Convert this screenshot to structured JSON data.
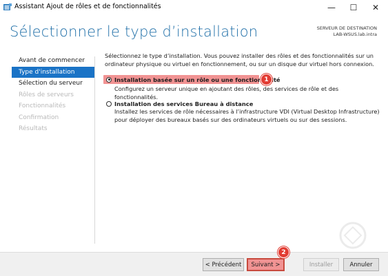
{
  "window": {
    "title": "Assistant Ajout de rôles et de fonctionnalités",
    "minimize_glyph": "—",
    "maximize_glyph": "☐",
    "close_glyph": "✕"
  },
  "header": {
    "title": "Sélectionner le type d’installation",
    "destination_label": "SERVEUR DE DESTINATION",
    "destination_server": "LAB-WSUS.lab.intra"
  },
  "nav": {
    "items": [
      {
        "label": "Avant de commencer",
        "state": "normal"
      },
      {
        "label": "Type d'installation",
        "state": "active"
      },
      {
        "label": "Sélection du serveur",
        "state": "normal"
      },
      {
        "label": "Rôles de serveurs",
        "state": "disabled"
      },
      {
        "label": "Fonctionnalités",
        "state": "disabled"
      },
      {
        "label": "Confirmation",
        "state": "disabled"
      },
      {
        "label": "Résultats",
        "state": "disabled"
      }
    ]
  },
  "content": {
    "intro": "Sélectionnez le type d’installation. Vous pouvez installer des rôles et des fonctionnalités sur un ordinateur physique ou virtuel en fonctionnement, ou sur un disque dur virtuel hors connexion.",
    "options": [
      {
        "label": "Installation basée sur un rôle ou une fonctionnalité",
        "description": "Configurez un serveur unique en ajoutant des rôles, des services de rôle et des fonctionnalités.",
        "selected": true,
        "badge": "1"
      },
      {
        "label": "Installation des services Bureau à distance",
        "description": "Installez les services de rôle nécessaires à l’infrastructure VDI (Virtual Desktop Infrastructure) pour déployer des bureaux basés sur des ordinateurs virtuels ou sur des sessions.",
        "selected": false
      }
    ]
  },
  "footer": {
    "previous_label": "< Précédent",
    "next_label": "Suivant >",
    "next_badge": "2",
    "install_label": "Installer",
    "cancel_label": "Annuler"
  },
  "colors": {
    "accent": "#1a73c6",
    "title_blue": "#1f6fa8",
    "highlight": "#f19393",
    "badge": "#e23c33"
  },
  "icons": {
    "app": "server-manager-icon",
    "watermark": "watermark-logo"
  }
}
